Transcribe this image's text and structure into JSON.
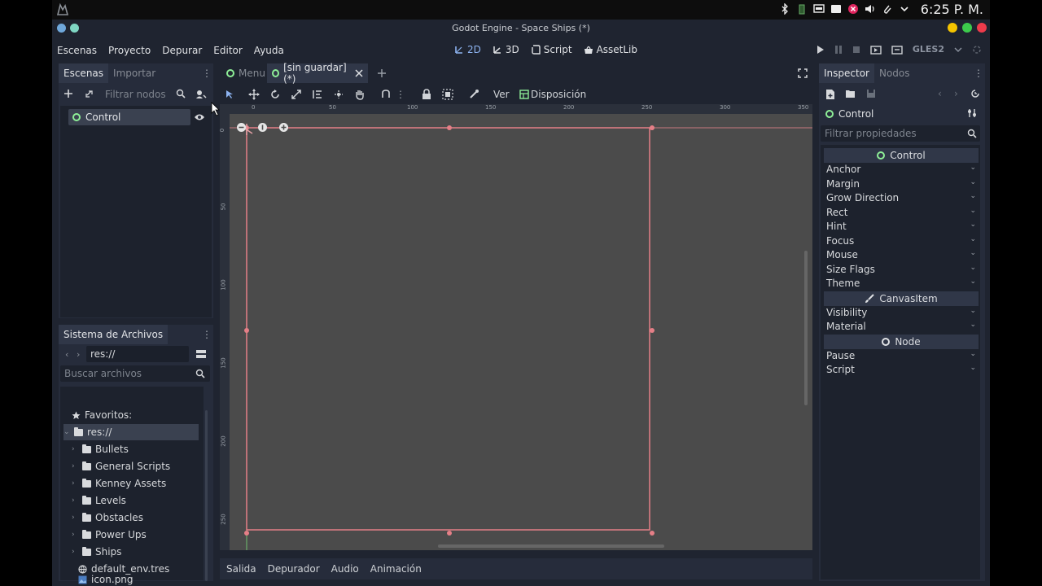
{
  "os": {
    "clock": "6:25 P. M.",
    "tray_icons": [
      "bluetooth-icon",
      "battery-icon",
      "display-icon",
      "mail-icon",
      "notification-icon",
      "volume-icon",
      "clip-icon",
      "chevron-down-icon"
    ]
  },
  "window": {
    "title": "Godot Engine - Space Ships (*)"
  },
  "menubar": {
    "menus": [
      "Escenas",
      "Proyecto",
      "Depurar",
      "Editor",
      "Ayuda"
    ],
    "modes": [
      {
        "label": "2D",
        "icon": "2d-icon",
        "active": true
      },
      {
        "label": "3D",
        "icon": "3d-icon",
        "active": false
      },
      {
        "label": "Script",
        "icon": "script-icon",
        "active": false
      },
      {
        "label": "AssetLib",
        "icon": "assetlib-icon",
        "active": false
      }
    ],
    "renderer": "GLES2"
  },
  "scene_panel": {
    "tabs": [
      "Escenas",
      "Importar"
    ],
    "filter_placeholder": "Filtrar nodos",
    "root_node": "Control"
  },
  "filesystem": {
    "title": "Sistema de Archivos",
    "path": "res://",
    "search_placeholder": "Buscar archivos",
    "favorites_label": "Favoritos:",
    "root_label": "res://",
    "folders": [
      "Bullets",
      "General Scripts",
      "Kenney Assets",
      "Levels",
      "Obstacles",
      "Power Ups",
      "Ships"
    ],
    "files": [
      "default_env.tres",
      "icon.png"
    ]
  },
  "editor": {
    "tabs": [
      {
        "label": "Menu",
        "active": false
      },
      {
        "label": "[sin guardar](*)",
        "active": true
      }
    ],
    "toolbar_labels": {
      "view": "Ver",
      "layout": "Disposición"
    },
    "ruler_top": [
      "0",
      "50",
      "100",
      "150",
      "200",
      "250",
      "300",
      "350"
    ],
    "ruler_left": [
      "0",
      "50",
      "100",
      "150",
      "200",
      "250"
    ],
    "bottom_tabs": [
      "Salida",
      "Depurador",
      "Audio",
      "Animación"
    ]
  },
  "inspector": {
    "tabs": [
      "Inspector",
      "Nodos"
    ],
    "node_name": "Control",
    "filter_placeholder": "Filtrar propiedades",
    "sections": [
      {
        "header": "Control",
        "props": [
          "Anchor",
          "Margin",
          "Grow Direction",
          "Rect",
          "Hint",
          "Focus",
          "Mouse",
          "Size Flags",
          "Theme"
        ]
      },
      {
        "header": "CanvasItem",
        "props": [
          "Visibility",
          "Material"
        ]
      },
      {
        "header": "Node",
        "props": [
          "Pause",
          "Script"
        ]
      }
    ]
  },
  "colors": {
    "accent": "#8db3f0",
    "control_node": "#8eef97",
    "selection_rect": "#e57f87",
    "panel": "#262c3b",
    "base": "#1f2430"
  }
}
